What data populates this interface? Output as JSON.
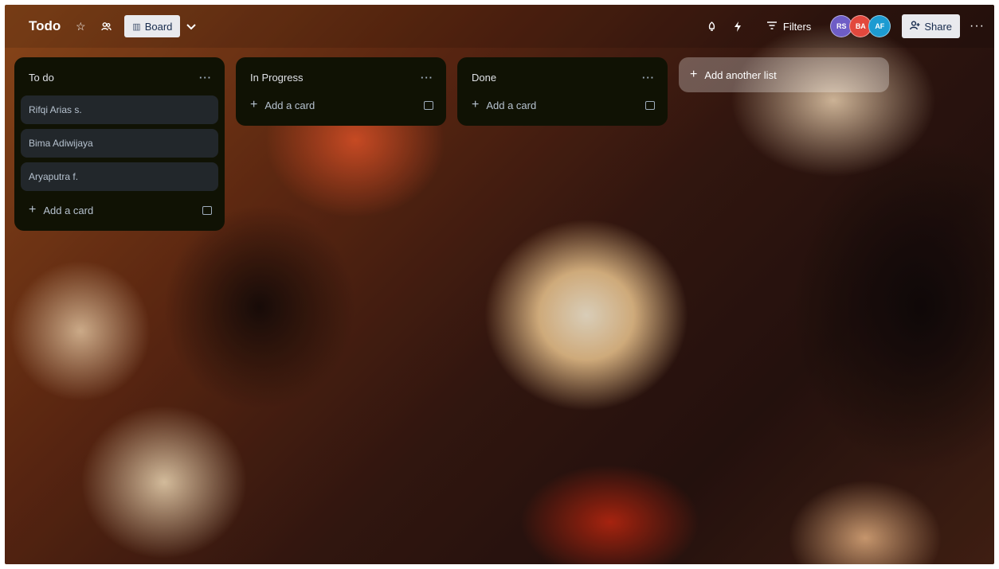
{
  "header": {
    "title": "Todo",
    "view_label": "Board",
    "filters_label": "Filters",
    "share_label": "Share",
    "icons": {
      "star": "star-icon",
      "visibility": "team-visibility-icon",
      "board_view": "board-view-icon",
      "chevron": "chevron-down-icon",
      "power_ups": "rocket-icon",
      "automation": "lightning-icon",
      "filter": "filter-icon",
      "share": "add-member-icon",
      "more": "more-icon"
    },
    "avatars": [
      {
        "initials": "RS",
        "color": "#6e5dc6"
      },
      {
        "initials": "BA",
        "color": "#e2483d"
      },
      {
        "initials": "AF",
        "color": "#1d9bd1"
      }
    ]
  },
  "lists": [
    {
      "title": "To do",
      "cards": [
        "Rifqi Arias s.",
        "Bima Adiwijaya",
        "Aryaputra f."
      ],
      "add_card_label": "Add a card"
    },
    {
      "title": "In Progress",
      "cards": [],
      "add_card_label": "Add a card"
    },
    {
      "title": "Done",
      "cards": [],
      "add_card_label": "Add a card"
    }
  ],
  "add_list_label": "Add another list",
  "colors": {
    "list_background": "#101204",
    "card_background": "#22272b",
    "text_primary": "#b6c2cf"
  }
}
